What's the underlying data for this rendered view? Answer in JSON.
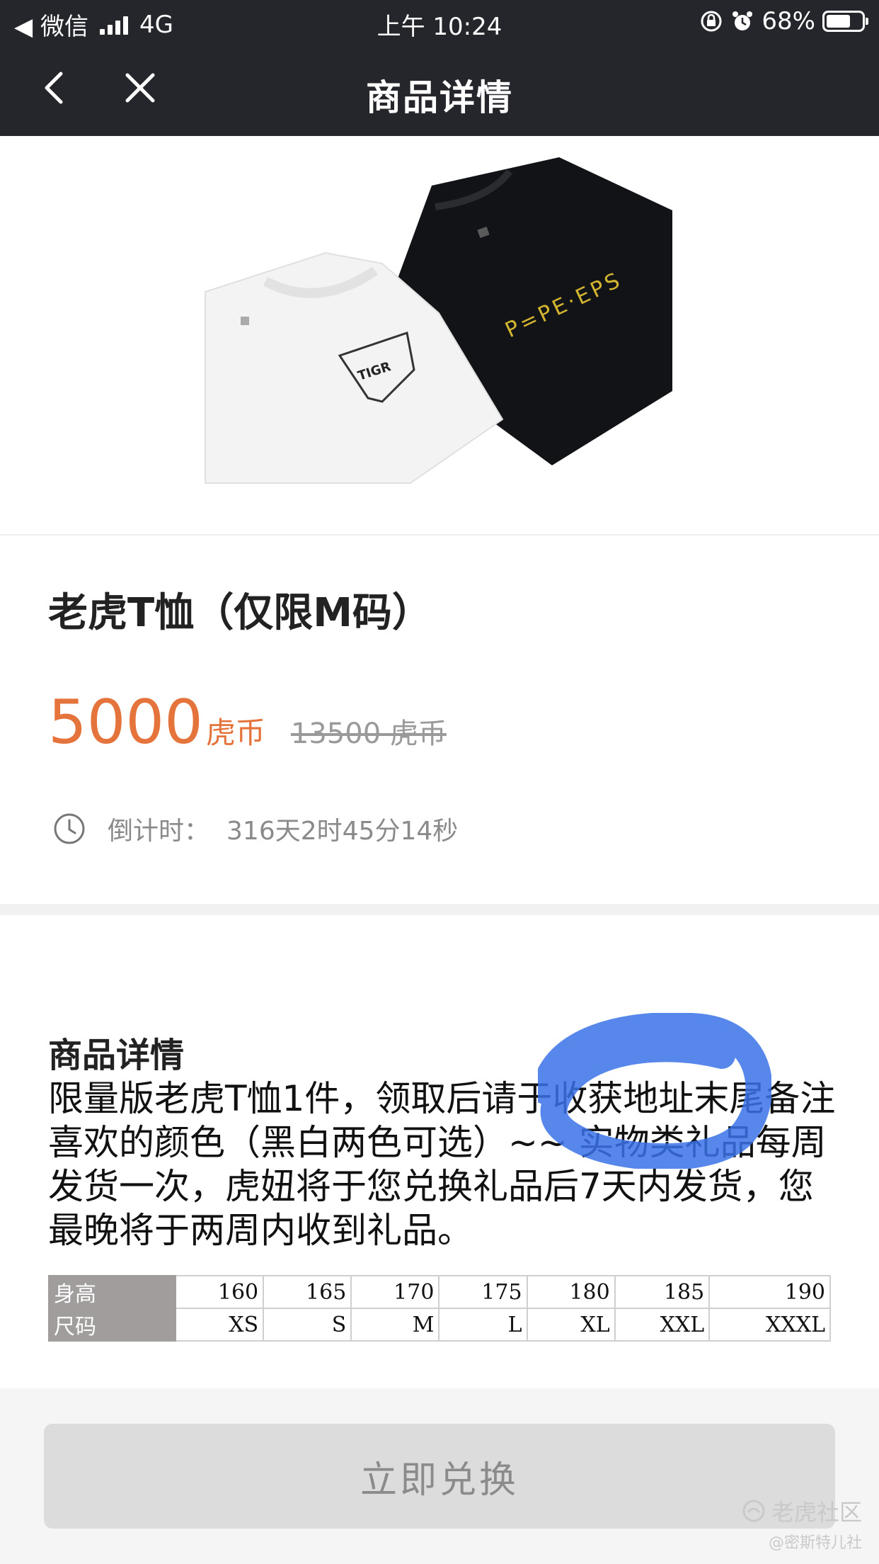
{
  "status_bar": {
    "carrier": "◀ 微信",
    "network": "4G",
    "time": "上午 10:24",
    "battery": "68%",
    "battery_level": 0.68
  },
  "nav": {
    "title": "商品详情"
  },
  "product": {
    "name": "老虎T恤（仅限M码）",
    "price": "5000",
    "price_unit": "虎币",
    "original_price": "13500 虎币",
    "shirt_logo_white": "TIGR",
    "shirt_logo_black": "P=PE·EPS"
  },
  "countdown": {
    "label": "倒计时：",
    "value": "316天2时45分14秒"
  },
  "details": {
    "title": "商品详情",
    "description": "限量版老虎T恤1件，领取后请于收获地址末尾备注喜欢的颜色（黑白两色可选）~~ 实物类礼品每周发货一次，虎妞将于您兑换礼品后7天内发货，您最晚将于两周内收到礼品。"
  },
  "size_table": {
    "rows": [
      {
        "label": "身高",
        "values": [
          "160",
          "165",
          "170",
          "175",
          "180",
          "185",
          "190"
        ]
      },
      {
        "label": "尺码",
        "values": [
          "XS",
          "S",
          "M",
          "L",
          "XL",
          "XXL",
          "XXXL"
        ]
      }
    ]
  },
  "action": {
    "redeem_label": "立即兑换"
  },
  "watermark": {
    "brand": "老虎社区",
    "sub": "@密斯特儿社"
  },
  "colors": {
    "nav_bg": "#24262b",
    "accent": "#e5743c",
    "scribble": "#3a72e8"
  },
  "icons": [
    "back-icon",
    "close-icon",
    "clock-icon",
    "lock-rotation-icon",
    "alarm-icon",
    "battery-icon",
    "signal-icon",
    "tiger-logo-icon"
  ]
}
